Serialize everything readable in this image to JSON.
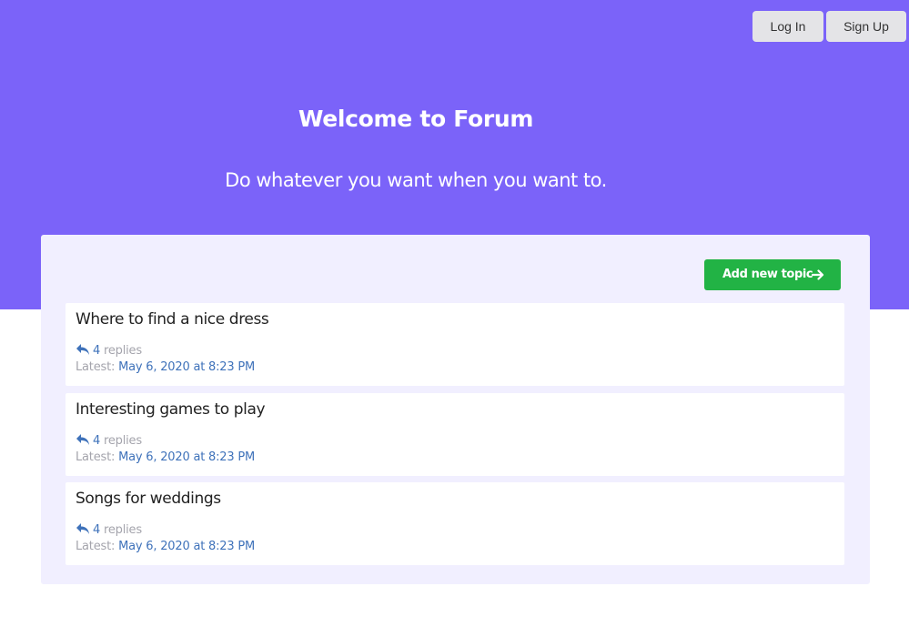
{
  "header": {
    "login_label": "Log In",
    "signup_label": "Sign Up",
    "title": "Welcome to Forum",
    "subtitle": "Do whatever you want when you want to."
  },
  "toolbar": {
    "add_topic_label": "Add new topic",
    "add_topic_icon": "arrow-right-icon"
  },
  "colors": {
    "hero": "#7b63f9",
    "panel": "#f1efff",
    "add_button": "#22b345",
    "link": "#3f72ba",
    "muted": "#a4a4ac"
  },
  "topics": [
    {
      "title": "Where to find a nice dress",
      "reply_count": "4",
      "replies_label": "replies",
      "latest_label": "Latest:",
      "latest_date": "May 6, 2020 at 8:23 PM"
    },
    {
      "title": "Interesting games to play",
      "reply_count": "4",
      "replies_label": "replies",
      "latest_label": "Latest:",
      "latest_date": "May 6, 2020 at 8:23 PM"
    },
    {
      "title": "Songs for weddings",
      "reply_count": "4",
      "replies_label": "replies",
      "latest_label": "Latest:",
      "latest_date": "May 6, 2020 at 8:23 PM"
    }
  ]
}
